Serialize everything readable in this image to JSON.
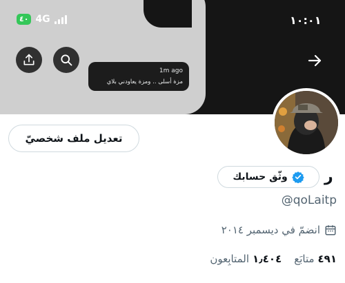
{
  "status_bar": {
    "time": "١٠:٠١",
    "network": "4G",
    "battery": "٤٠"
  },
  "notification": {
    "time": "1m ago",
    "message": "مزة أسلى .. ومزة يعاودني بلاي"
  },
  "header": {
    "share_icon": "share-icon",
    "search_icon": "search-icon",
    "back_icon": "arrow-right-icon"
  },
  "profile": {
    "display_name": "ر",
    "verify_label": "وثّق حسابك",
    "handle": "@qoLaitp",
    "joined": "انضمّ في ديسمبر ٢٠١٤",
    "edit_label": "تعديل ملف شخصيّ",
    "following_count": "٤٩١",
    "following_label": "متابَع",
    "followers_count": "١٫٤٠٤",
    "followers_label": "المتابِعون"
  },
  "colors": {
    "verified_blue": "#1d9bf0",
    "battery_green": "#34c759",
    "secondary_text": "#536471"
  }
}
